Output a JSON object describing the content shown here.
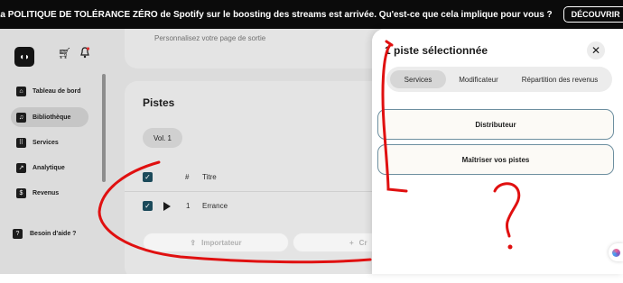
{
  "banner": {
    "text": "La POLITIQUE DE TOLÉRANCE ZÉRO de Spotify sur le boosting des streams est arrivée. Qu'est-ce que cela implique pour vous ?",
    "button": "DÉCOUVRIR"
  },
  "sidebar": {
    "logo": "◖◗",
    "items": [
      {
        "label": "Tableau de bord",
        "icon": "home-icon"
      },
      {
        "label": "Bibliothèque",
        "icon": "music-note-icon"
      },
      {
        "label": "Services",
        "icon": "grid-icon"
      },
      {
        "label": "Analytique",
        "icon": "chart-icon"
      },
      {
        "label": "Revenus",
        "icon": "dollar-icon"
      }
    ],
    "help": "Besoin d'aide ?"
  },
  "main": {
    "top_card_text": "Personnalisez votre page de sortie",
    "section_title": "Pistes",
    "volume_pill": "Vol. 1",
    "header_hash": "#",
    "header_title": "Titre",
    "track_number": "1",
    "track_title": "Errance",
    "import_button": "Importateur",
    "create_button": "Cr"
  },
  "panel": {
    "title": "1 piste sélectionnée",
    "close": "✕",
    "tabs": [
      "Services",
      "Modificateur",
      "Répartition des revenus"
    ],
    "options": [
      "Distributeur",
      "Maîtriser vos pistes"
    ]
  },
  "colors": {
    "accent": "#1b4a5a",
    "annotation": "#e01010",
    "banner": "#0b0b0b"
  }
}
